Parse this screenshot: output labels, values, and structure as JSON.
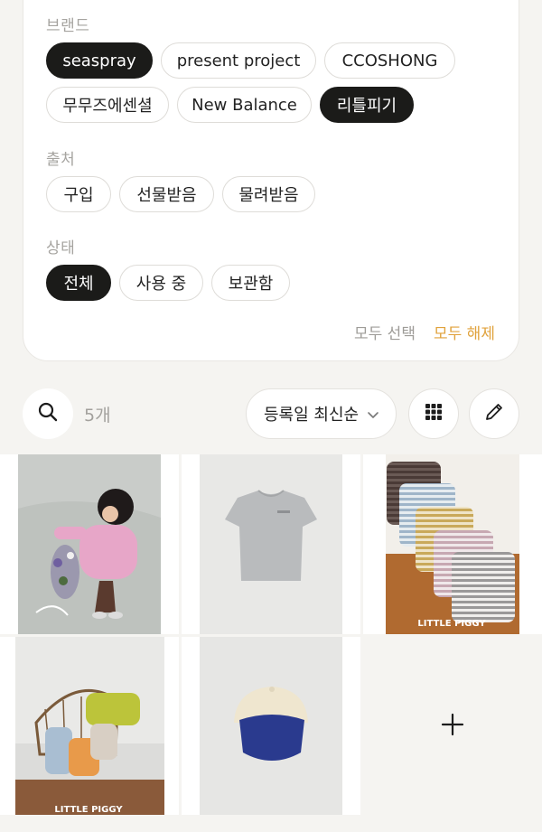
{
  "filters": {
    "brand": {
      "label": "브랜드",
      "chips": [
        "seaspray",
        "present project",
        "CCOSHONG",
        "무무즈에센셜",
        "New Balance",
        "리틀피기"
      ]
    },
    "source": {
      "label": "출처",
      "chips": [
        "구입",
        "선물받음",
        "물려받음"
      ]
    },
    "status": {
      "label": "상태",
      "chips": [
        "전체",
        "사용 중",
        "보관함"
      ]
    },
    "select_all": "모두 선택",
    "clear_all": "모두 해제"
  },
  "toolbar": {
    "count": "5개",
    "sort_label": "등록일 최신순"
  },
  "grid": {
    "watermark": "LITTLE PIGGY",
    "add_icon": "plus-icon"
  },
  "colors": {
    "accent": "#e0a23c",
    "chip_active_bg": "#1b1b19",
    "background": "#f5f4f1"
  }
}
